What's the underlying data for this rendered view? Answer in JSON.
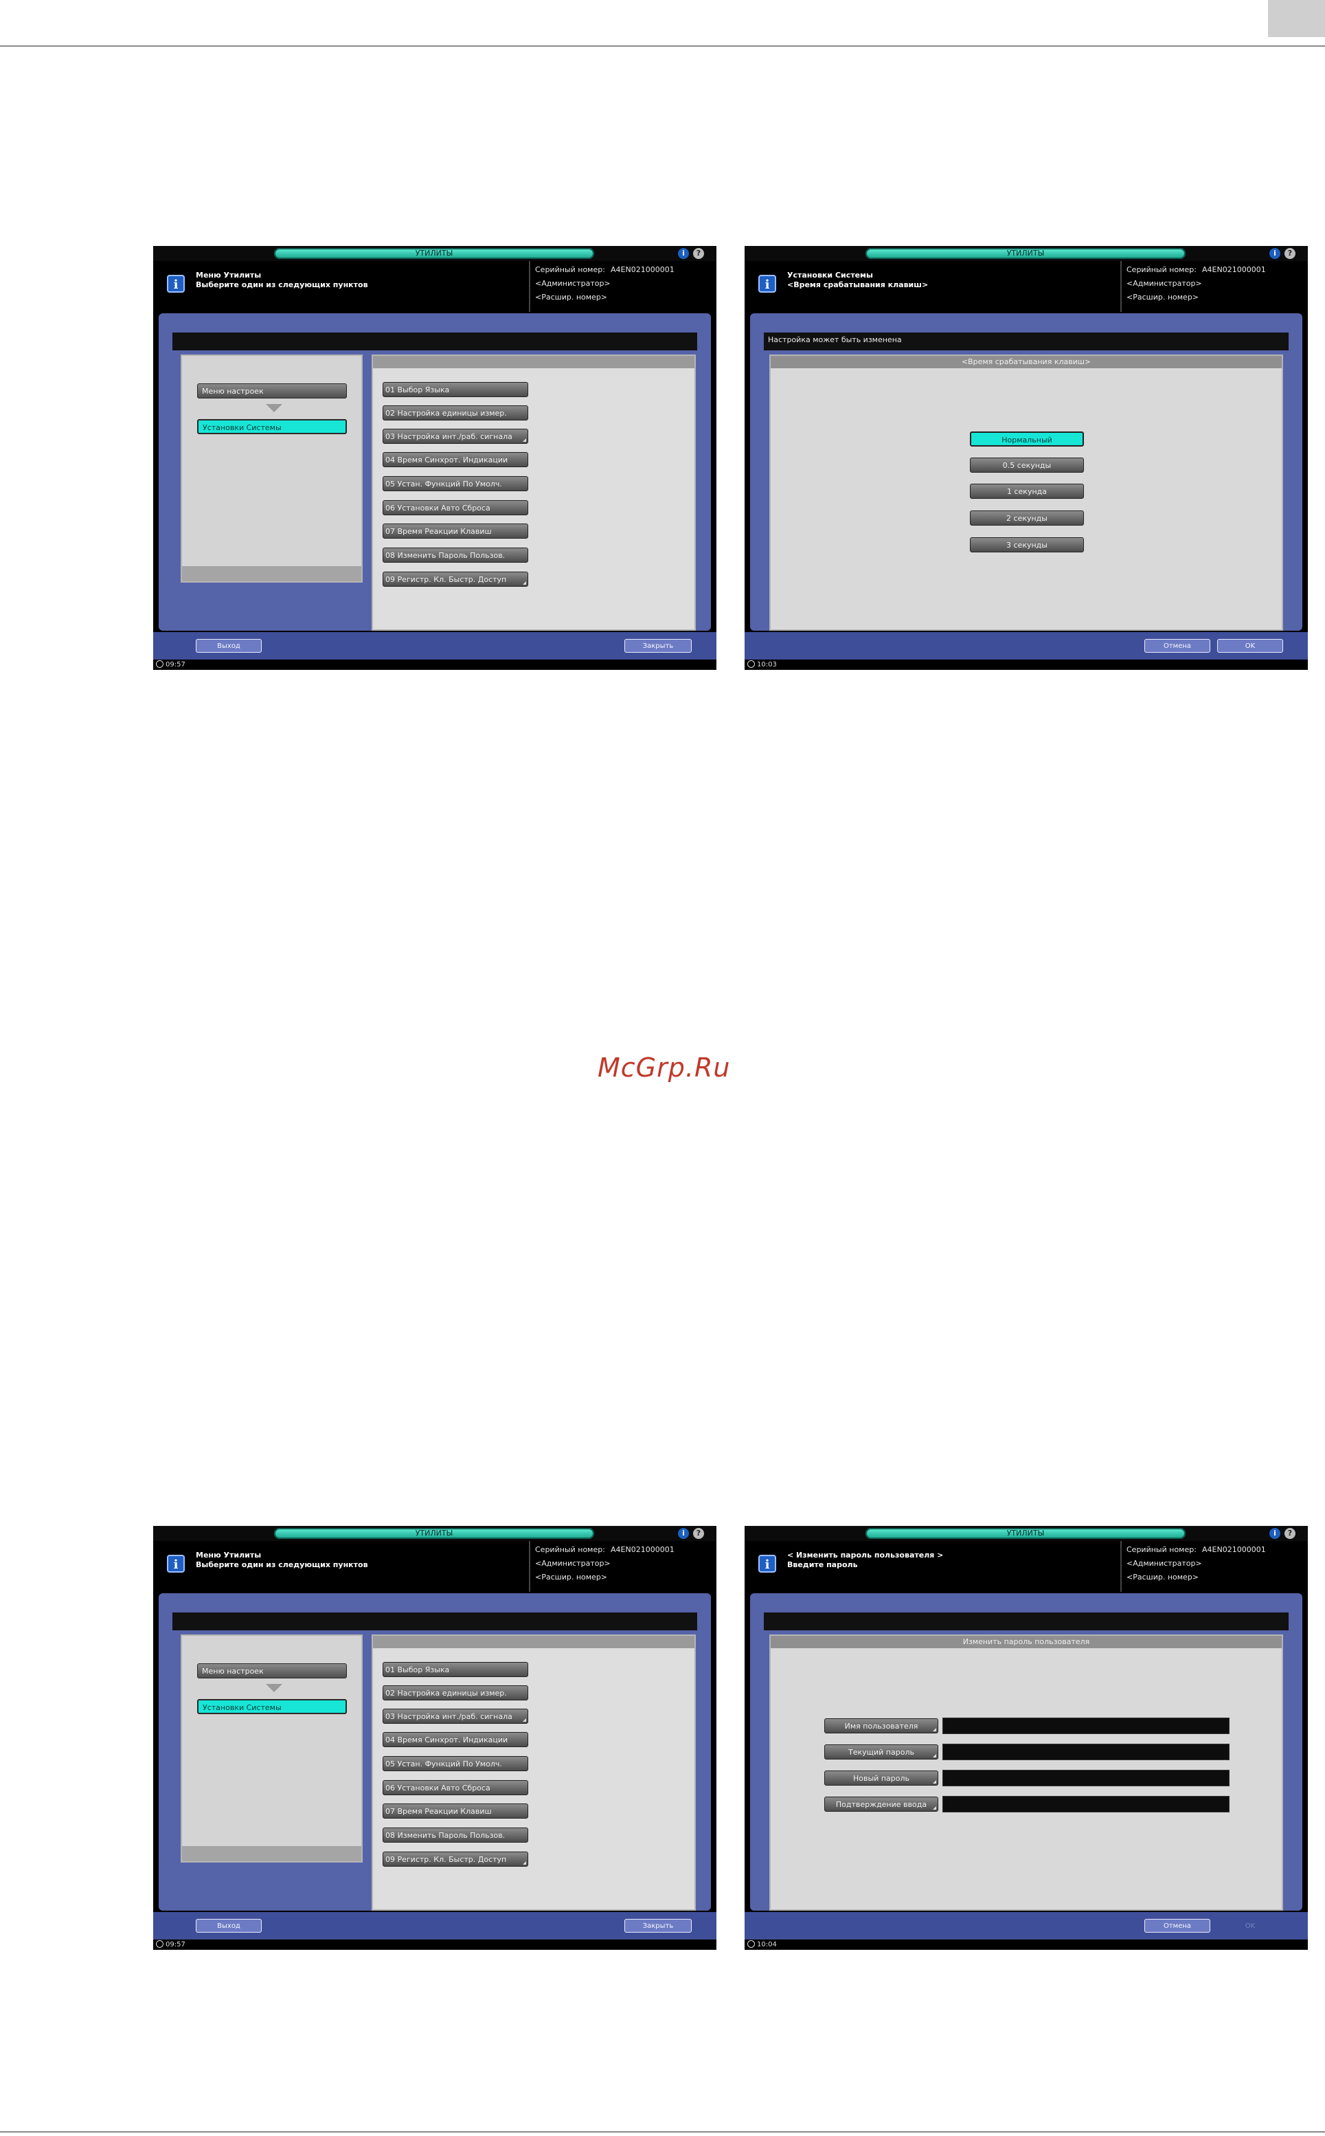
{
  "watermark": "McGrp.Ru",
  "screens": {
    "menu_a": {
      "title": "УТИЛИТЫ",
      "message": [
        "Меню Утилиты",
        "Выберите один из следующих пунктов"
      ],
      "serial_label": "Серийный номер:",
      "serial_value": "A4EN021000001",
      "admin": "<Администратор>",
      "ext_number": "<Расшир. номер>",
      "nav": [
        "Меню настроек",
        "Установки Системы"
      ],
      "items": [
        "01 Выбор Языка",
        "02 Настройка единицы измер.",
        "03 Настройка инт./раб. сигнала",
        "04 Время Синхрот. Индикации",
        "05 Устан. Функций По Умолч.",
        "06 Установки Авто Сброса",
        "07 Время Реакции Клавиш",
        "08 Изменить Пароль Пользов.",
        "09 Регистр. Кл. Быстр. Доступ"
      ],
      "buttons": [
        "Выход",
        "Закрыть"
      ],
      "clock": "09:57"
    },
    "keytime": {
      "title": "УТИЛИТЫ",
      "message": [
        "Установки Системы",
        "<Время срабатывания клавиш>"
      ],
      "serial_label": "Серийный номер:",
      "serial_value": "A4EN021000001",
      "admin": "<Администратор>",
      "ext_number": "<Расшир. номер>",
      "subheading": "Настройка может быть изменена",
      "panel_title": "<Время срабатывания клавиш>",
      "options": [
        "Нормальный",
        "0.5 секунды",
        "1 секунда",
        "2 секунды",
        "3 секунды"
      ],
      "selected_option": "Нормальный",
      "buttons": [
        "Отмена",
        "OK"
      ],
      "clock": "10:03"
    },
    "menu_b": {
      "title": "УТИЛИТЫ",
      "message": [
        "Меню Утилиты",
        "Выберите один из следующих пунктов"
      ],
      "serial_label": "Серийный номер:",
      "serial_value": "A4EN021000001",
      "admin": "<Администратор>",
      "ext_number": "<Расшир. номер>",
      "nav": [
        "Меню настроек",
        "Установки Системы"
      ],
      "items": [
        "01 Выбор Языка",
        "02 Настройка единицы измер.",
        "03 Настройка инт./раб. сигнала",
        "04 Время Синхрот. Индикации",
        "05 Устан. Функций По Умолч.",
        "06 Установки Авто Сброса",
        "07 Время Реакции Клавиш",
        "08 Изменить Пароль Пользов.",
        "09 Регистр. Кл. Быстр. Доступ"
      ],
      "buttons": [
        "Выход",
        "Закрыть"
      ],
      "clock": "09:57"
    },
    "password": {
      "title": "УТИЛИТЫ",
      "message": [
        "< Изменить пароль пользователя >",
        "Введите пароль"
      ],
      "serial_label": "Серийный номер:",
      "serial_value": "A4EN021000001",
      "admin": "<Администратор>",
      "ext_number": "<Расшир. номер>",
      "panel_title": "Изменить пароль пользователя",
      "fields": [
        "Имя пользователя",
        "Текущий пароль",
        "Новый пароль",
        "Подтверждение ввода"
      ],
      "buttons": [
        "Отмена",
        "OK"
      ],
      "clock": "10:04"
    }
  }
}
